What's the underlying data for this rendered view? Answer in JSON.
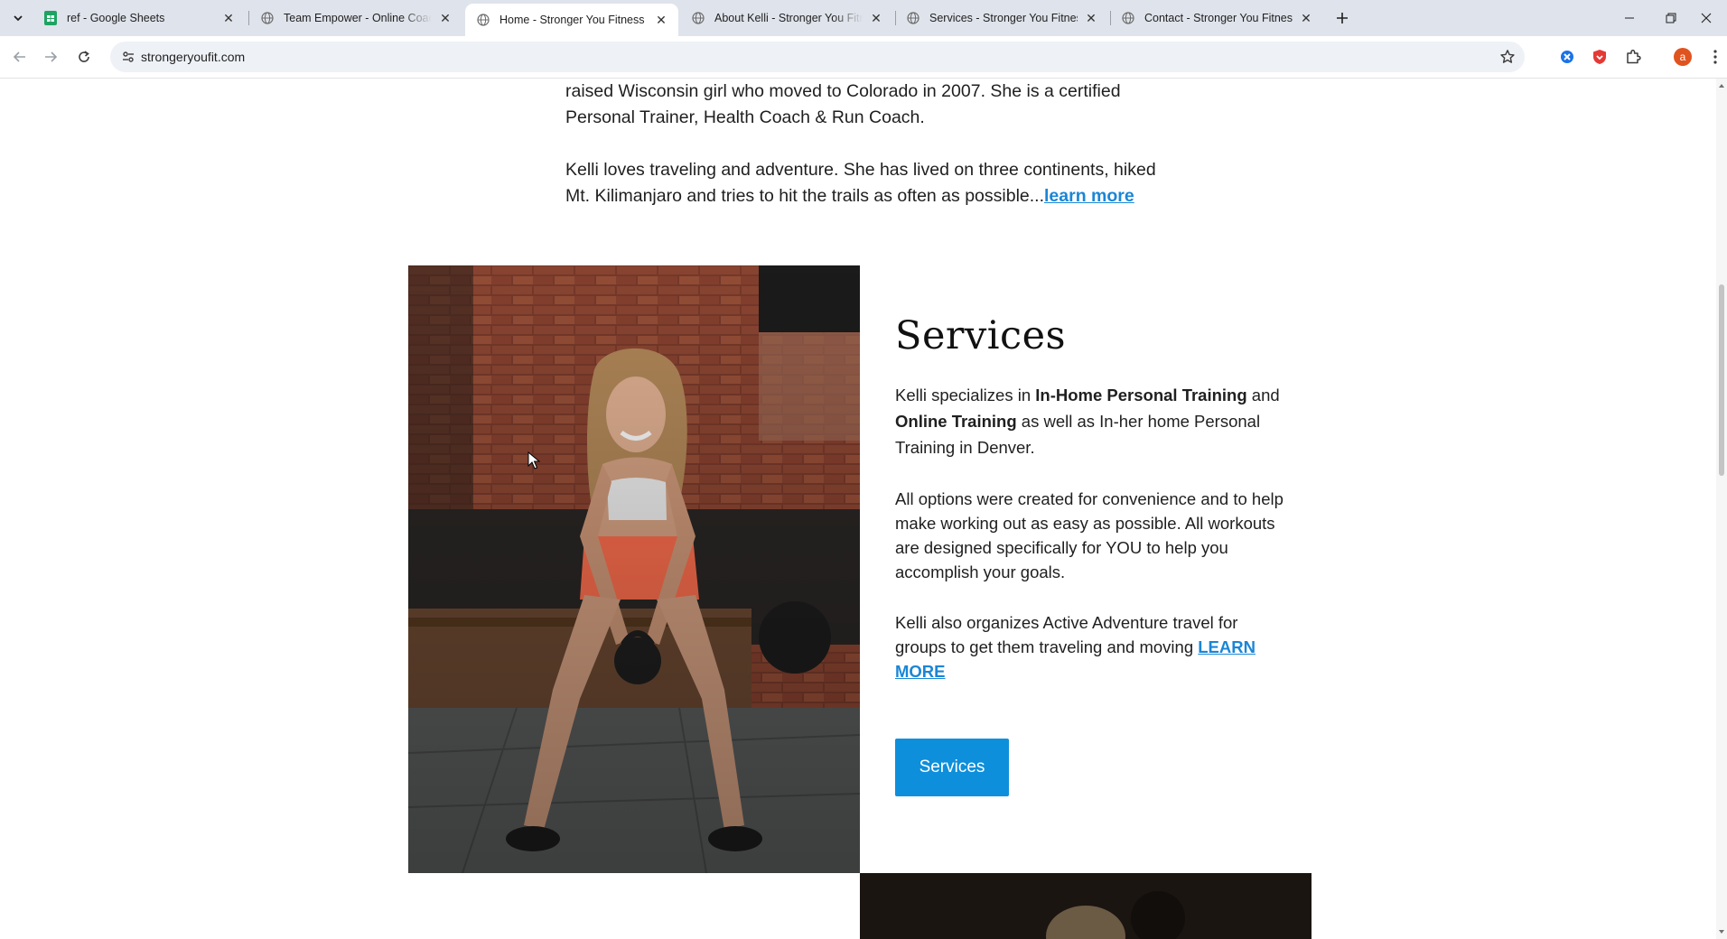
{
  "browser": {
    "tabs": [
      {
        "title": "ref - Google Sheets",
        "icon": "google-sheets-icon",
        "active": false
      },
      {
        "title": "Team Empower - Online Coachi",
        "icon": "globe-icon",
        "active": false
      },
      {
        "title": "Home - Stronger You Fitness",
        "icon": "globe-icon",
        "active": true
      },
      {
        "title": "About Kelli - Stronger You Fitne",
        "icon": "globe-icon",
        "active": false
      },
      {
        "title": "Services - Stronger You Fitness",
        "icon": "globe-icon",
        "active": false
      },
      {
        "title": "Contact - Stronger You Fitness",
        "icon": "globe-icon",
        "active": false
      }
    ],
    "address_bar": {
      "url": "strongeryoufit.com"
    },
    "profile_initial": "a",
    "accent_color": "#1a86d6"
  },
  "about": {
    "paragraph1": "raised Wisconsin girl who moved to Colorado in 2007. She is a certified Personal Trainer, Health Coach & Run Coach.",
    "paragraph2_text": "Kelli loves traveling and adventure. She has lived on three continents, hiked Mt. Kilimanjaro and tries to hit the trails as often as possible...",
    "paragraph2_link": "learn more"
  },
  "services": {
    "heading": "Services",
    "p1_a": "Kelli specializes in ",
    "p1_b": "In-Home Personal Training",
    "p1_c": " and ",
    "p1_d": "Online Training",
    "p1_e": " as well as In-her home Personal Training in Denver.",
    "p2": "All options were created for convenience and to help make working out as easy as possible. All workouts are designed specifically for YOU to help you accomplish your goals.",
    "p3_text": "Kelli also organizes Active Adventure travel for groups to get them traveling and moving ",
    "p3_link": "LEARN MORE",
    "button_label": "Services",
    "button_color": "#0e8fdb"
  }
}
